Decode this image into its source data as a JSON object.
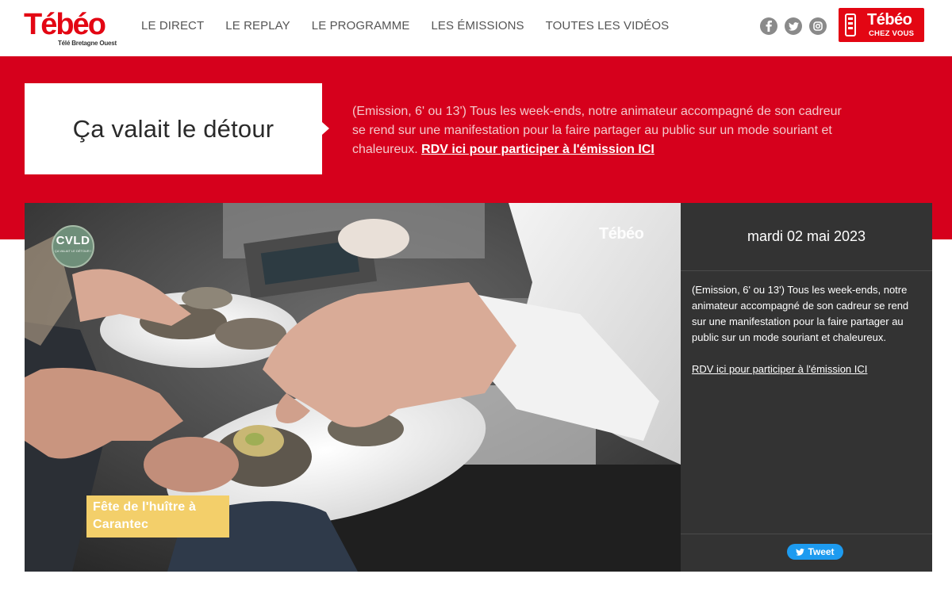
{
  "brand": {
    "name": "Tébéo",
    "tagline": "Télé Bretagne Ouest"
  },
  "nav": {
    "items": [
      {
        "label": "LE DIRECT"
      },
      {
        "label": "LE REPLAY"
      },
      {
        "label": "LE PROGRAMME"
      },
      {
        "label": "LES ÉMISSIONS"
      },
      {
        "label": "TOUTES LES VIDÉOS"
      }
    ]
  },
  "socials": {
    "icons": [
      "facebook-icon",
      "twitter-icon",
      "instagram-icon"
    ]
  },
  "chez_vous": {
    "line1": "Tébéo",
    "line2": "CHEZ VOUS"
  },
  "hero": {
    "title": "Ça valait le détour",
    "description": "(Emission, 6' ou 13') Tous les week-ends, notre animateur accompagné de son cadreur se rend sur une manifestation pour la faire partager au public sur un mode souriant et chaleureux.",
    "link": "RDV ici pour participer à l'émission ICI"
  },
  "video": {
    "badge": "CVLD",
    "badge_sub": "ÇA VALAIT LE DÉTOUR !",
    "watermark": "Tébéo",
    "caption_line1": "Fête de l'huître à",
    "caption_line2": "Carantec"
  },
  "side": {
    "date": "mardi 02 mai 2023",
    "description": "(Emission, 6' ou 13') Tous les week-ends, notre animateur accompagné de son cadreur se rend sur une manifestation pour la faire partager au public sur un mode souriant et chaleureux.",
    "link": "RDV ici pour participer à l'émission ICI",
    "tweet": "Tweet"
  },
  "colors": {
    "brand_red": "#d6001c",
    "logo_red": "#e30613",
    "panel_dark": "#333333",
    "caption_yellow": "#f3cf6a",
    "tweet_blue": "#1d9bf0"
  }
}
